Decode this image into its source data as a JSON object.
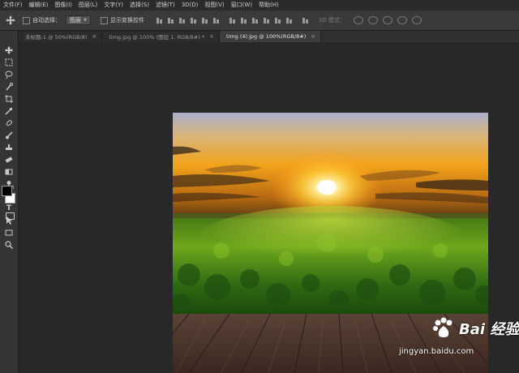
{
  "menu": [
    "文件(F)",
    "编辑(E)",
    "图像(I)",
    "图层(L)",
    "文字(Y)",
    "选择(S)",
    "滤镜(T)",
    "3D(D)",
    "视图(V)",
    "窗口(W)",
    "帮助(H)"
  ],
  "options": {
    "auto_select_label": "自动选择：",
    "auto_select_value": "图层",
    "show_transform_label": "显示变换控件",
    "mode_3d_label": "3D 模式："
  },
  "tabs": [
    {
      "label": "未标题-1 @ 50%(RGB/8)",
      "close": "×"
    },
    {
      "label": "timg.jpg @ 100% (图层 1, RGB/8#) *",
      "close": "×"
    },
    {
      "label": "timg (4).jpg @ 100%(RGB/8#)",
      "close": "×"
    }
  ],
  "watermark": {
    "brand": "Bai 经验",
    "url": "jingyan.baidu.com"
  },
  "colors": {
    "foreground": "#000000",
    "background": "#ffffff"
  },
  "icons": [
    "move-tool-icon",
    "marquee-tool-icon",
    "lasso-tool-icon",
    "quick-select-icon",
    "crop-tool-icon",
    "eyedropper-icon",
    "healing-brush-icon",
    "brush-tool-icon",
    "clone-stamp-icon",
    "eraser-icon",
    "gradient-icon",
    "dodge-icon",
    "pen-tool-icon",
    "type-tool-icon",
    "path-select-icon",
    "shape-tool-icon",
    "zoom-tool-icon"
  ]
}
